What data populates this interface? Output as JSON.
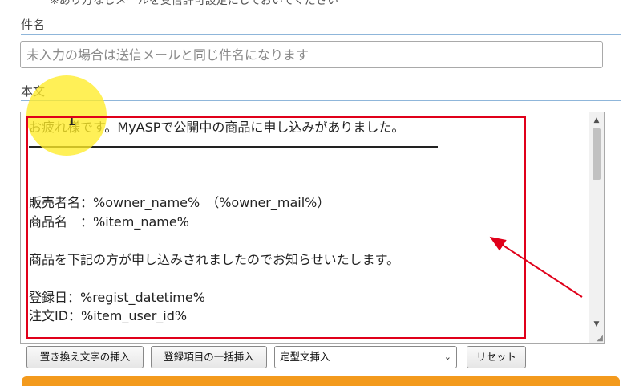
{
  "top_note": "※あり方なしメールを受信許可設定にしておいてください",
  "subject": {
    "label": "件名",
    "placeholder": "未入力の場合は送信メールと同じ件名になります"
  },
  "body": {
    "label": "本文",
    "lines": [
      "お疲れ様です。MyASPで公開中の商品に申し込みがありました。",
      "",
      "",
      "",
      "販売者名：%owner_name%　（%owner_mail%）",
      "商品名　：%item_name%",
      "",
      "商品を下記の方が申し込みされましたのでお知らせいたします。",
      "",
      "登録日：%regist_datetime%",
      "注文ID：%item_user_id%"
    ]
  },
  "buttons": {
    "insert_replace": "置き換え文字の挿入",
    "bulk_insert": "登録項目の一括挿入",
    "template_select": "定型文挿入",
    "reset": "リセット"
  },
  "icons": {
    "scroll_up": "scroll-up-arrow",
    "scroll_down": "scroll-down-arrow",
    "resize": "resize-grip",
    "dropdown": "chevron-down"
  },
  "colors": {
    "annotation_red": "#e0001a",
    "highlight_yellow": "#ffec28",
    "section_rule": "#8fb6da",
    "submit_orange": "#f39a1d"
  }
}
